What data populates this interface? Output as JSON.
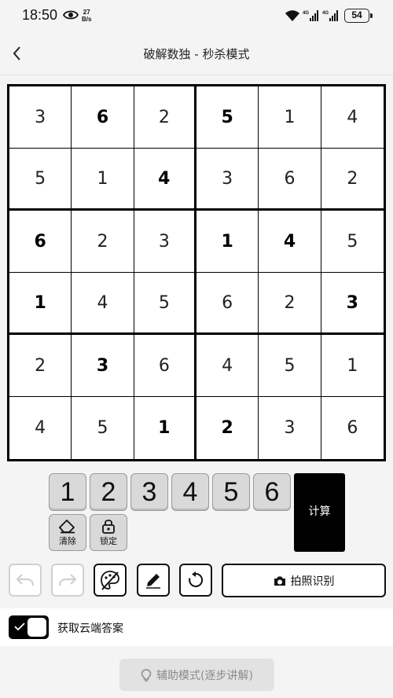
{
  "status_bar": {
    "time": "18:50",
    "net_speed_value": "27",
    "net_speed_unit": "B/s",
    "signal1": "4G",
    "signal2": "4G",
    "battery": "54"
  },
  "header": {
    "title": "破解数独 - 秒杀模式",
    "back_icon": "chevron-left-icon"
  },
  "board": {
    "size": 6,
    "rows": [
      [
        {
          "v": "3",
          "g": false
        },
        {
          "v": "6",
          "g": true
        },
        {
          "v": "2",
          "g": false
        },
        {
          "v": "5",
          "g": true
        },
        {
          "v": "1",
          "g": false
        },
        {
          "v": "4",
          "g": false
        }
      ],
      [
        {
          "v": "5",
          "g": false
        },
        {
          "v": "1",
          "g": false
        },
        {
          "v": "4",
          "g": true
        },
        {
          "v": "3",
          "g": false
        },
        {
          "v": "6",
          "g": false
        },
        {
          "v": "2",
          "g": false
        }
      ],
      [
        {
          "v": "6",
          "g": true
        },
        {
          "v": "2",
          "g": false
        },
        {
          "v": "3",
          "g": false
        },
        {
          "v": "1",
          "g": true
        },
        {
          "v": "4",
          "g": true
        },
        {
          "v": "5",
          "g": false
        }
      ],
      [
        {
          "v": "1",
          "g": true
        },
        {
          "v": "4",
          "g": false
        },
        {
          "v": "5",
          "g": false
        },
        {
          "v": "6",
          "g": false
        },
        {
          "v": "2",
          "g": false
        },
        {
          "v": "3",
          "g": true
        }
      ],
      [
        {
          "v": "2",
          "g": false
        },
        {
          "v": "3",
          "g": true
        },
        {
          "v": "6",
          "g": false
        },
        {
          "v": "4",
          "g": false
        },
        {
          "v": "5",
          "g": false
        },
        {
          "v": "1",
          "g": false
        }
      ],
      [
        {
          "v": "4",
          "g": false
        },
        {
          "v": "5",
          "g": false
        },
        {
          "v": "1",
          "g": true
        },
        {
          "v": "2",
          "g": true
        },
        {
          "v": "3",
          "g": false
        },
        {
          "v": "6",
          "g": false
        }
      ]
    ]
  },
  "keypad": {
    "numbers": [
      "1",
      "2",
      "3",
      "4",
      "5",
      "6"
    ],
    "clear_label": "清除",
    "lock_label": "锁定",
    "calc_label": "计算"
  },
  "actions": {
    "photo_label": "拍照识别"
  },
  "cloud": {
    "label": "获取云端答案",
    "enabled": true
  },
  "assist": {
    "label": "辅助模式(逐步讲解)",
    "enabled": false
  },
  "colors": {
    "accent": "#000000",
    "background": "#f4f4f4",
    "key_fill": "#d9d9d9",
    "disabled_text": "#8a8a8a"
  }
}
